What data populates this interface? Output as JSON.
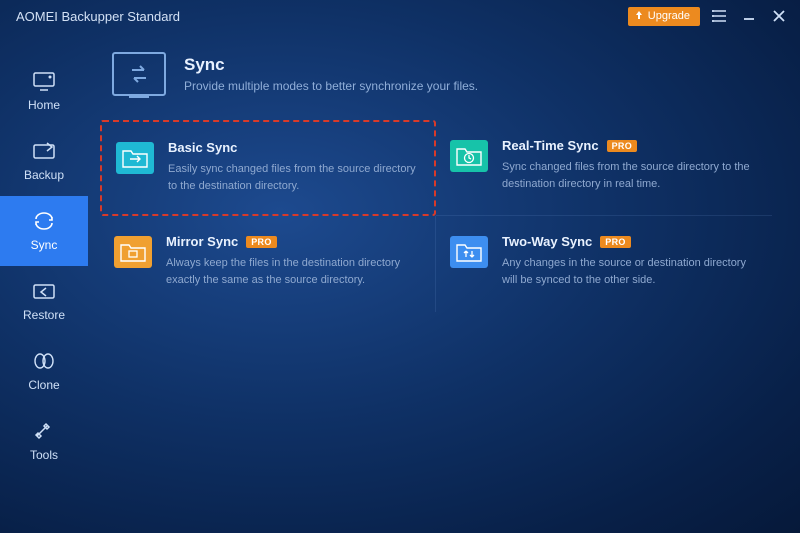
{
  "app": {
    "title": "AOMEI Backupper Standard"
  },
  "titlebar": {
    "upgrade_label": "Upgrade"
  },
  "sidebar": {
    "items": [
      {
        "label": "Home"
      },
      {
        "label": "Backup"
      },
      {
        "label": "Sync"
      },
      {
        "label": "Restore"
      },
      {
        "label": "Clone"
      },
      {
        "label": "Tools"
      }
    ],
    "active_index": 2
  },
  "page": {
    "title": "Sync",
    "subtitle": "Provide multiple modes to better synchronize your files."
  },
  "cards": [
    {
      "title": "Basic Sync",
      "desc": "Easily sync changed files from the source directory to the destination directory.",
      "pro": false,
      "icon_color": "cyan",
      "highlighted": true
    },
    {
      "title": "Real-Time Sync",
      "desc": "Sync changed files from the source directory to the destination directory in real time.",
      "pro": true,
      "icon_color": "teal"
    },
    {
      "title": "Mirror Sync",
      "desc": "Always keep the files in the destination directory exactly the same as the source directory.",
      "pro": true,
      "icon_color": "orange"
    },
    {
      "title": "Two-Way Sync",
      "desc": "Any changes in the source or destination directory will be synced to the other side.",
      "pro": true,
      "icon_color": "blue"
    }
  ],
  "badges": {
    "pro": "PRO"
  }
}
